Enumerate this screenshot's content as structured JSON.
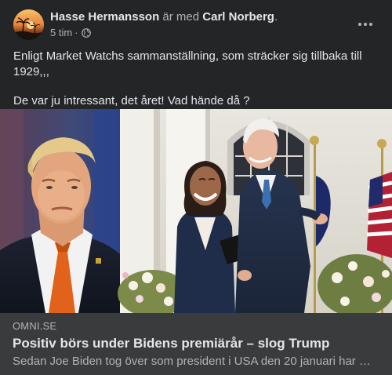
{
  "post": {
    "author": "Hasse Hermansson",
    "with_text": "är med",
    "tagged_person": "Carl Norberg",
    "tagged_suffix": ".",
    "time": "5 tim",
    "time_separator": "·",
    "audience_icon": "globe-icon",
    "more_icon": "more-horizontal-icon",
    "body": [
      "Enligt Market Watchs sammanställning, som sträcker sig tillbaka till 1929,,,",
      "De var ju intressant, det året! Vad hände då ?"
    ]
  },
  "link_preview": {
    "domain": "OMNI.SE",
    "title": "Positiv börs under Bidens premiärår – slog Trump",
    "description": "Sedan Joe Biden tog över som president i USA den 20 januari har …"
  },
  "colors": {
    "background": "#242526",
    "preview_background": "#3a3b3c",
    "primary_text": "#e4e6eb",
    "secondary_text": "#b0b3b8"
  }
}
